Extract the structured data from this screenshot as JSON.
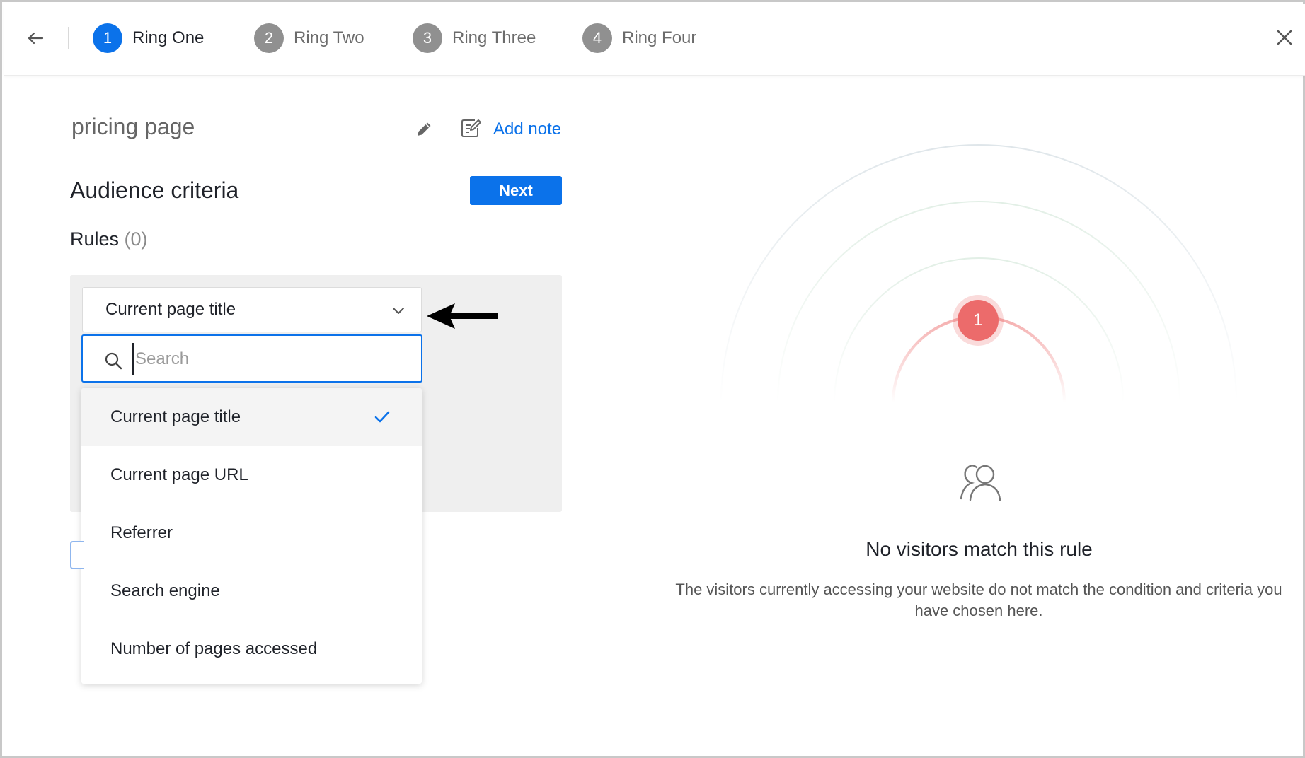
{
  "topbar": {
    "steps": [
      {
        "num": "1",
        "label": "Ring One"
      },
      {
        "num": "2",
        "label": "Ring Two"
      },
      {
        "num": "3",
        "label": "Ring Three"
      },
      {
        "num": "4",
        "label": "Ring Four"
      }
    ],
    "active_step": "Ring One",
    "icons": {
      "back": "arrow-left-icon",
      "close": "close-icon"
    }
  },
  "rule": {
    "name": "pricing page",
    "add_note_label": "Add note",
    "section_title": "Audience criteria",
    "next_label": "Next",
    "rules_label": "Rules",
    "rules_count": "(0)"
  },
  "criteria": {
    "selected": "Current page title",
    "search_placeholder": "Search",
    "search_value": "",
    "options": [
      "Current page title",
      "Current page URL",
      "Referrer",
      "Search engine",
      "Number of pages accessed"
    ]
  },
  "preview": {
    "visitor_count": "1",
    "empty_title": "No visitors match this rule",
    "empty_description": "The visitors currently accessing your website do not match the condition and criteria you have chosen here."
  },
  "colors": {
    "accent": "#0b72ea",
    "visitor": "#ec6b6b",
    "step_inactive": "#909090"
  }
}
